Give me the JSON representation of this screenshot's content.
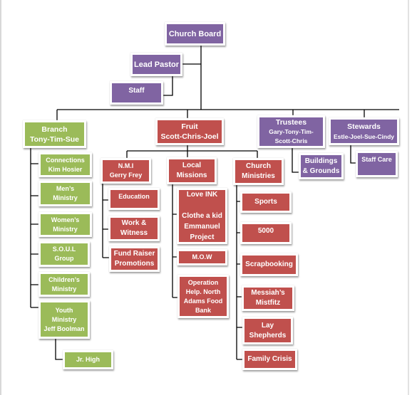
{
  "colors": {
    "board": "#8064a2",
    "fruit": "#c0504d",
    "branch": "#9bbb59",
    "lines": "#000000"
  },
  "nodes": {
    "church_board": "Church Board",
    "lead_pastor": "Lead Pastor",
    "staff": "Staff",
    "branch": "Branch\nTony-Tim-Sue",
    "fruit": "Fruit\nScott-Chris-Joel",
    "trustees_title": "Trustees",
    "trustees_members": "Gary-Tony-Tim-\nScott-Chris",
    "stewards_title": "Stewards",
    "stewards_members": "Estle-Joel-Sue-Cindy",
    "buildings": "Buildings\n& Grounds",
    "staff_care": "Staff Care",
    "nmi": "N.M.I\nGerry Frey",
    "local_missions": "Local\nMissions",
    "church_ministries": "Church\nMinistries",
    "education": "Education",
    "work_witness": "Work &\nWitness",
    "fund_raiser": "Fund Raiser\nPromotions",
    "love_ink": "Love INK\n\nClothe a kid\nEmmanuel\nProject",
    "mow": "M.O.W",
    "operation_help": "Operation\nHelp.  North\nAdams Food\nBank",
    "sports": "Sports",
    "n5000": "5000",
    "scrapbooking": "Scrapbooking",
    "messiahs": "Messiah’s\nMistfitz",
    "lay_shepherds": "Lay\nShepherds",
    "family_crisis": "Family Crisis",
    "connections": "Connections\nKim Hosier",
    "mens": "Men’s\nMinistry",
    "womens": "Women’s\nMinistry",
    "soul": "S.O.U.L\nGroup",
    "childrens": "Children’s\nMinistry",
    "youth": "Youth\nMinistry\nJeff Boolman",
    "jr_high": "Jr. High"
  }
}
